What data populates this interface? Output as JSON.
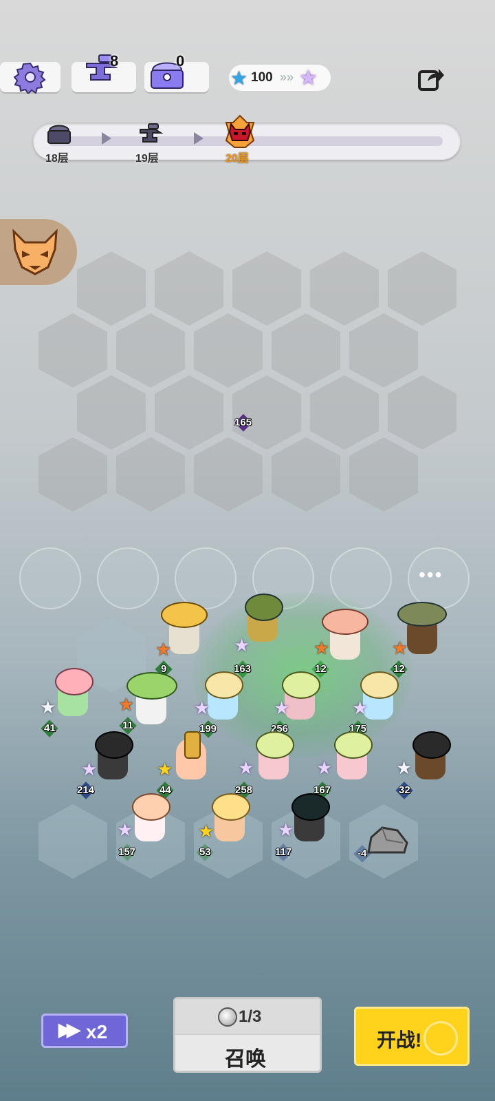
{
  "top_bar": {
    "anvil_count": "8",
    "chest_count": "0",
    "star_value": "100"
  },
  "floors": [
    {
      "label": "18层"
    },
    {
      "label": "19层"
    },
    {
      "label": "20层",
      "current": true
    }
  ],
  "enemy_marker": {
    "level": "165"
  },
  "bench_more": "•••",
  "units": [
    {
      "level": "9",
      "star": "★",
      "badge": "g"
    },
    {
      "level": "163",
      "star": "★",
      "badge": "g"
    },
    {
      "level": "12",
      "star": "★",
      "badge": "g"
    },
    {
      "level": "12",
      "star": "★",
      "badge": "g"
    },
    {
      "level": "41",
      "star": "★",
      "badge": "g"
    },
    {
      "level": "11",
      "star": "★",
      "badge": "g"
    },
    {
      "level": "199",
      "star": "★",
      "badge": "g"
    },
    {
      "level": "256",
      "star": "★",
      "badge": "g"
    },
    {
      "level": "175",
      "star": "★",
      "badge": "g"
    },
    {
      "level": "214",
      "star": "★",
      "badge": "b"
    },
    {
      "level": "44",
      "star": "★",
      "badge": "g"
    },
    {
      "level": "258",
      "star": "★",
      "badge": "g"
    },
    {
      "level": "167",
      "star": "★",
      "badge": "g"
    },
    {
      "level": "32",
      "star": "★",
      "badge": "b"
    },
    {
      "level": "157",
      "star": "★",
      "badge": "g"
    },
    {
      "level": "53",
      "star": "★",
      "badge": "g"
    },
    {
      "level": "117",
      "star": "★",
      "badge": "b"
    },
    {
      "level": "-4",
      "star": "",
      "badge": "b"
    }
  ],
  "controls": {
    "speed_label": "x2",
    "summon_count": "1/3",
    "summon_label": "召唤",
    "fight_label": "开战!"
  },
  "colors": {
    "speed_button": "#6f67d8",
    "fight_button": "#ffd21c",
    "current_floor": "#c8172b"
  }
}
